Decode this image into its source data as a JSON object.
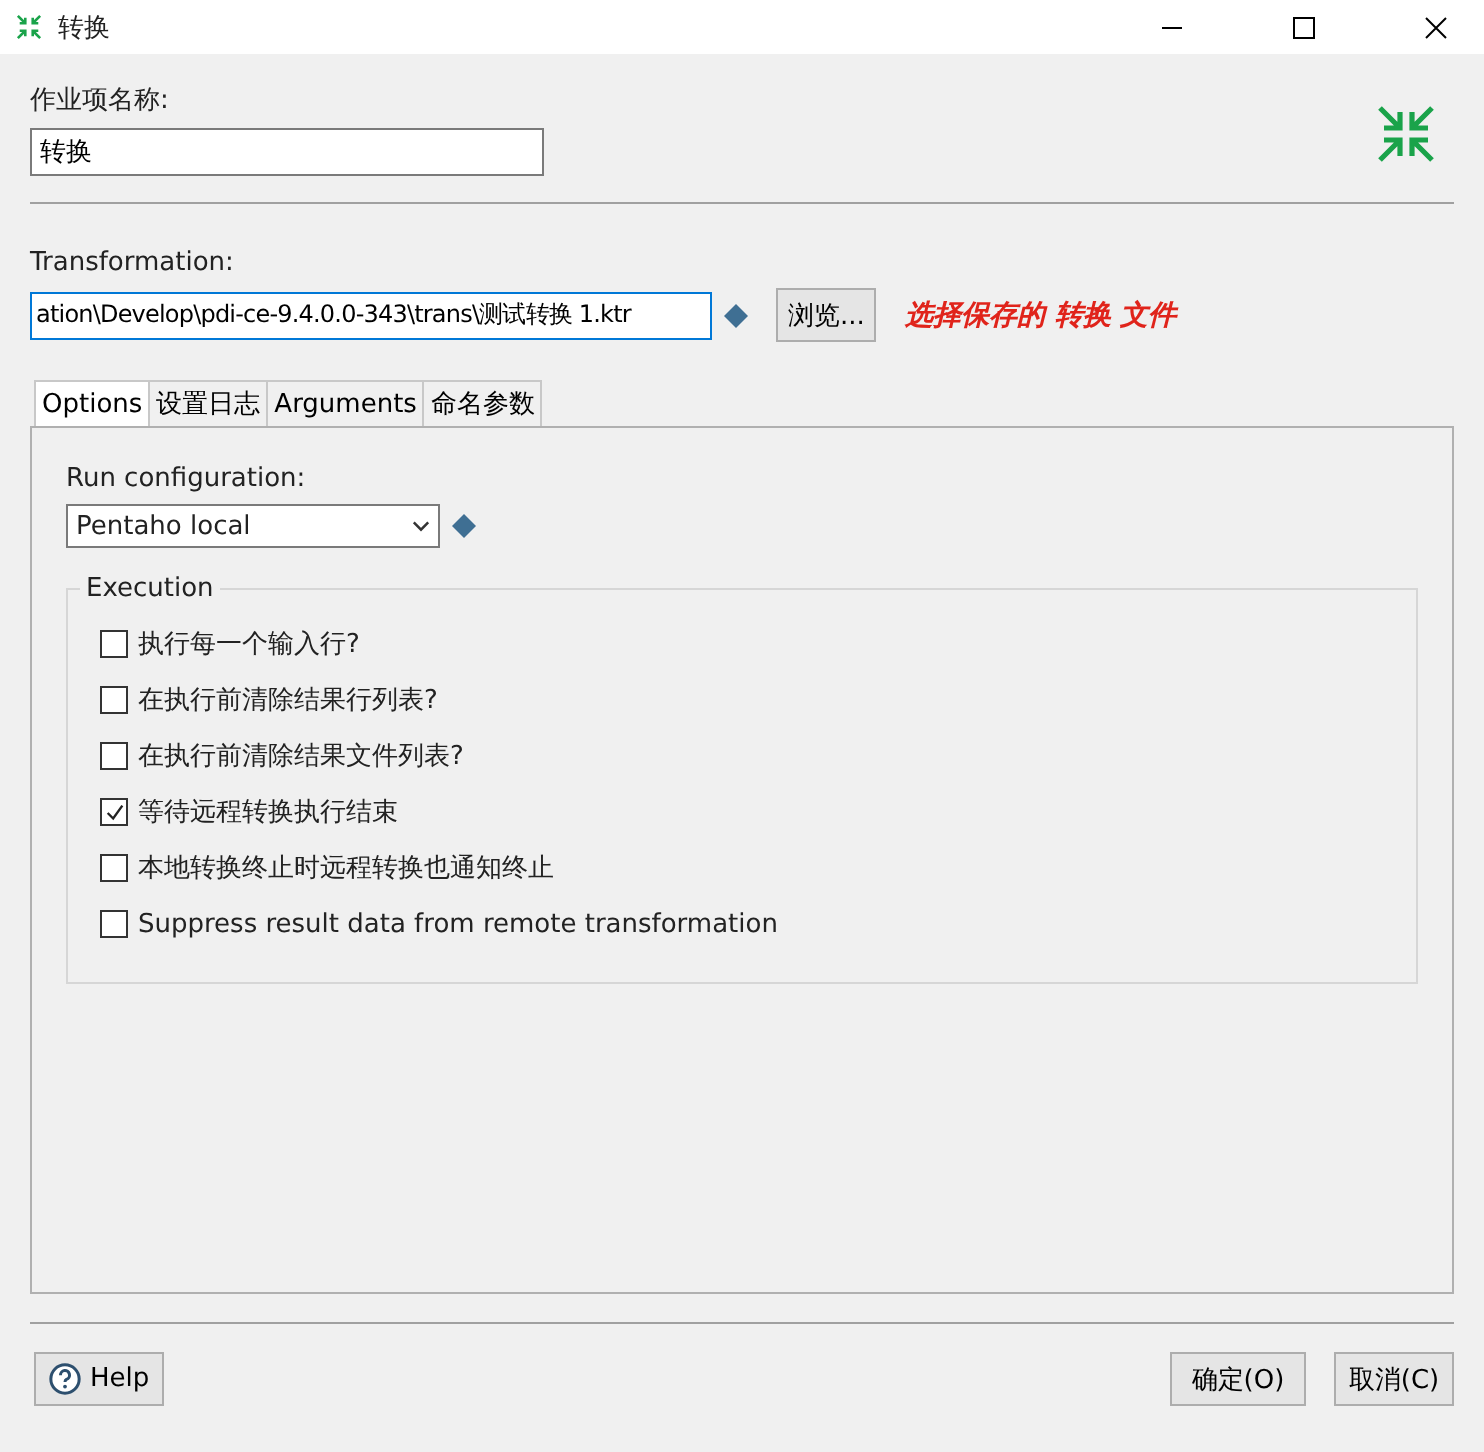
{
  "window": {
    "title": "转换"
  },
  "job_name": {
    "label": "作业项名称:",
    "value": "转换"
  },
  "transformation": {
    "label": "Transformation:",
    "value": "ation\\Develop\\pdi-ce-9.4.0.0-343\\trans\\测试转换 1.ktr",
    "browse": "浏览...",
    "note": "选择保存的 转换 文件"
  },
  "tabs": [
    {
      "label": "Options",
      "selected": true
    },
    {
      "label": "设置日志",
      "selected": false
    },
    {
      "label": "Arguments",
      "selected": false
    },
    {
      "label": "命名参数",
      "selected": false
    }
  ],
  "run_configuration": {
    "label": "Run configuration:",
    "value": "Pentaho local"
  },
  "execution": {
    "title": "Execution",
    "options": [
      {
        "label": "执行每一个输入行?",
        "checked": false
      },
      {
        "label": "在执行前清除结果行列表?",
        "checked": false
      },
      {
        "label": "在执行前清除结果文件列表?",
        "checked": false
      },
      {
        "label": "等待远程转换执行结束",
        "checked": true
      },
      {
        "label": "本地转换终止时远程转换也通知终止",
        "checked": false
      },
      {
        "label": "Suppress result data from remote transformation",
        "checked": false
      }
    ]
  },
  "buttons": {
    "help": "Help",
    "ok": "确定(O)",
    "cancel": "取消(C)"
  }
}
